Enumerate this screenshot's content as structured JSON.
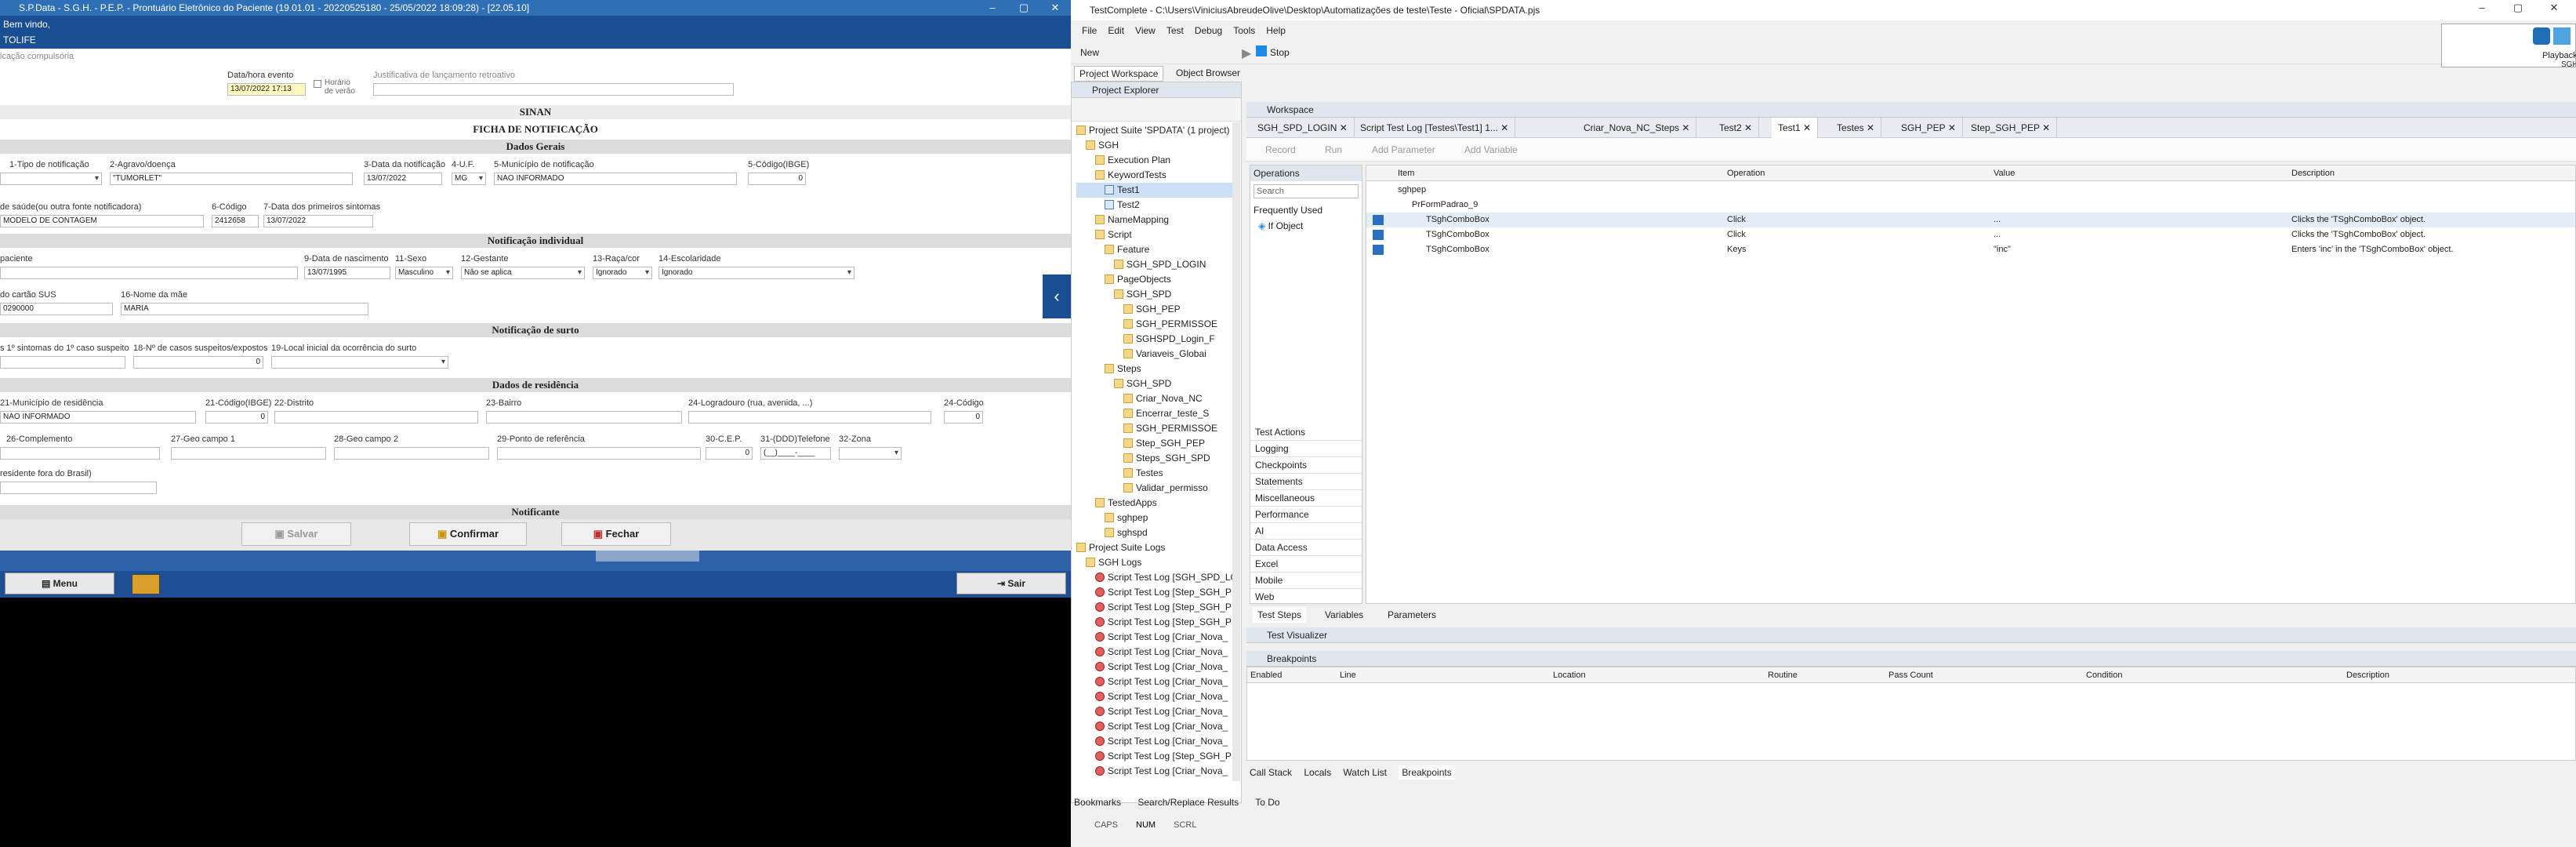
{
  "sgh": {
    "title": "S.P.Data - S.G.H. - P.E.P. - Prontuário Eletrônico do Paciente (19.01.01 - 20220525180 - 25/05/2022 18:09:28) - [22.05.10]",
    "welcome": "Bem vindo,",
    "user": "TOLIFE",
    "compulsory": "icação compulsória",
    "event_label": "Data/hora evento",
    "event_value": "13/07/2022 17:13",
    "summer_label": "Horário de verão",
    "justification_label": "Justificativa de lançamento retroativo",
    "sinan": "SINAN",
    "ficha": "FICHA DE NOTIFICAÇÃO",
    "dados_gerais": "Dados Gerais",
    "f1_label": "1-Tipo de notificação",
    "f2_label": "2-Agravo/doença",
    "f2_value": "\"TUMORLET\"",
    "f3_label": "3-Data da notificação",
    "f3_value": "13/07/2022",
    "f4_label": "4-U.F.",
    "f4_value": "MG",
    "f5_label": "5-Município de notificação",
    "f5_value": "NAO INFORMADO",
    "f5b_label": "5-Código(IBGE)",
    "f5b_value": "0",
    "f6a_label": "de saúde(ou outra fonte notificadora)",
    "f6a_value": "MODELO DE CONTAGEM",
    "f6_label": "6-Código",
    "f6_value": "2412658",
    "f7_label": "7-Data dos primeiros sintomas",
    "f7_value": "13/07/2022",
    "notif_ind": "Notificação individual",
    "paciente_label": "paciente",
    "f9_label": "9-Data de nascimento",
    "f9_value": "13/07/1995",
    "f11_label": "11-Sexo",
    "f11_value": "Masculino",
    "f12_label": "12-Gestante",
    "f12_value": "Não se aplica",
    "f13_label": "13-Raça/cor",
    "f13_value": "Ignorado",
    "f14_label": "14-Escolaridade",
    "f14_value": "Ignorado",
    "sus_label": "do cartão SUS",
    "sus_value": "0290000",
    "f16_label": "16-Nome da mãe",
    "f16_value": "MARIA",
    "surto": "Notificação de surto",
    "s17_label": "s 1º sintomas do 1º caso suspeito",
    "s18_label": "18-Nº de casos suspeitos/expostos",
    "s18_value": "0",
    "s19_label": "19-Local inicial da ocorrência do surto",
    "residencia": "Dados de residência",
    "r21_label": "21-Município de residência",
    "r21_value": "NAO INFORMADO",
    "r21b_label": "21-Código(IBGE)",
    "r21b_value": "0",
    "r22_label": "22-Distrito",
    "r23_label": "23-Bairro",
    "r24_label": "24-Logradouro (rua, avenida, ...)",
    "r24b_label": "24-Código",
    "r24b_value": "0",
    "r26_label": "26-Complemento",
    "r27_label": "27-Geo campo 1",
    "r28_label": "28-Geo campo 2",
    "r29_label": "29-Ponto de referência",
    "r30_label": "30-C.E.P.",
    "r30_value": "0",
    "r31_label": "31-(DDD)Telefone",
    "r31_value": "(__)____-____",
    "r32_label": "32-Zona",
    "brasil_label": "residente fora do Brasil)",
    "notificante": "Notificante",
    "btn_salvar": "Salvar",
    "btn_confirmar": "Confirmar",
    "btn_fechar": "Fechar",
    "btn_menu": "Menu",
    "btn_sair": "Sair"
  },
  "tc": {
    "title": "TestComplete - C:\\Users\\ViniciusAbreudeOlive\\Desktop\\Automatizações de teste\\Teste - Oficial\\SPDATA.pjs",
    "menu": [
      "File",
      "Edit",
      "View",
      "Test",
      "Debug",
      "Tools",
      "Help"
    ],
    "new_label": "New",
    "stop_label": "Stop",
    "ws_tab1": "Project Workspace",
    "ws_tab2": "Object Browser",
    "pe_title": "Project Explorer",
    "workspace_title": "Workspace",
    "tree": [
      "Project Suite 'SPDATA' (1 project)",
      "SGH",
      "Execution Plan",
      "KeywordTests",
      "Test1",
      "Test2",
      "NameMapping",
      "Script",
      "Feature",
      "SGH_SPD_LOGIN",
      "PageObjects",
      "SGH_SPD",
      "SGH_PEP",
      "SGH_PERMISSOE",
      "SGHSPD_Login_F",
      "Variaveis_Globai",
      "Steps",
      "SGH_SPD",
      "Criar_Nova_NC",
      "Encerrar_teste_S",
      "SGH_PERMISSOE",
      "Step_SGH_PEP",
      "Steps_SGH_SPD",
      "Testes",
      "Validar_permisso",
      "TestedApps",
      "sghpep",
      "sghspd",
      "Project Suite Logs",
      "SGH Logs",
      "Script Test Log [SGH_SPD_LO",
      "Script Test Log [Step_SGH_P",
      "Script Test Log [Step_SGH_P",
      "Script Test Log [Step_SGH_P",
      "Script Test Log [Criar_Nova_",
      "Script Test Log [Criar_Nova_",
      "Script Test Log [Criar_Nova_",
      "Script Test Log [Criar_Nova_",
      "Script Test Log [Criar_Nova_",
      "Script Test Log [Criar_Nova_",
      "Script Test Log [Criar_Nova_",
      "Script Test Log [Criar_Nova_",
      "Script Test Log [Step_SGH_P",
      "Script Test Log [Criar_Nova_"
    ],
    "tabs": [
      "SGH_SPD_LOGIN",
      "Script Test Log [Testes\\Test1] 1...",
      "Criar_Nova_NC_Steps",
      "Test2",
      "Test1",
      "Testes",
      "SGH_PEP",
      "Step_SGH_PEP"
    ],
    "record": "Record",
    "run": "Run",
    "add_param": "Add Parameter",
    "add_var": "Add Variable",
    "operations": "Operations",
    "search": "Search",
    "freq_used": "Frequently Used",
    "if_object": "If Object",
    "op_cats": [
      "Test Actions",
      "Logging",
      "Checkpoints",
      "Statements",
      "Miscellaneous",
      "Performance",
      "AI",
      "Data Access",
      "Excel",
      "Mobile",
      "Web"
    ],
    "cols": [
      "Item",
      "Operation",
      "Value",
      "Description"
    ],
    "root_item": "sghpep",
    "sub_item": "PrFormPadrao_9",
    "rows": [
      {
        "item": "TSghComboBox",
        "op": "Click",
        "value": "...",
        "desc": "Clicks the 'TSghComboBox' object."
      },
      {
        "item": "TSghComboBox",
        "op": "Click",
        "value": "...",
        "desc": "Clicks the 'TSghComboBox' object."
      },
      {
        "item": "TSghComboBox",
        "op": "Keys",
        "value": "\"inc\"",
        "desc": "Enters 'inc' in the 'TSghComboBox' object."
      }
    ],
    "bottom_tabs": [
      "Test Steps",
      "Variables",
      "Parameters"
    ],
    "visualizer": "Test Visualizer",
    "breakpoints": "Breakpoints",
    "bp_cols": [
      "Enabled",
      "Line",
      "Location",
      "Routine",
      "Pass Count",
      "Condition",
      "Description"
    ],
    "debug_tabs": [
      "Call Stack",
      "Locals",
      "Watch List",
      "Breakpoints"
    ],
    "pe_bottom_tabs": [
      "Bookmarks",
      "Search/Replace Results",
      "To Do"
    ],
    "status": [
      "CAPS",
      "NUM",
      "SCRL"
    ],
    "playback_label": "Playback",
    "playback_sub": "SGH"
  }
}
